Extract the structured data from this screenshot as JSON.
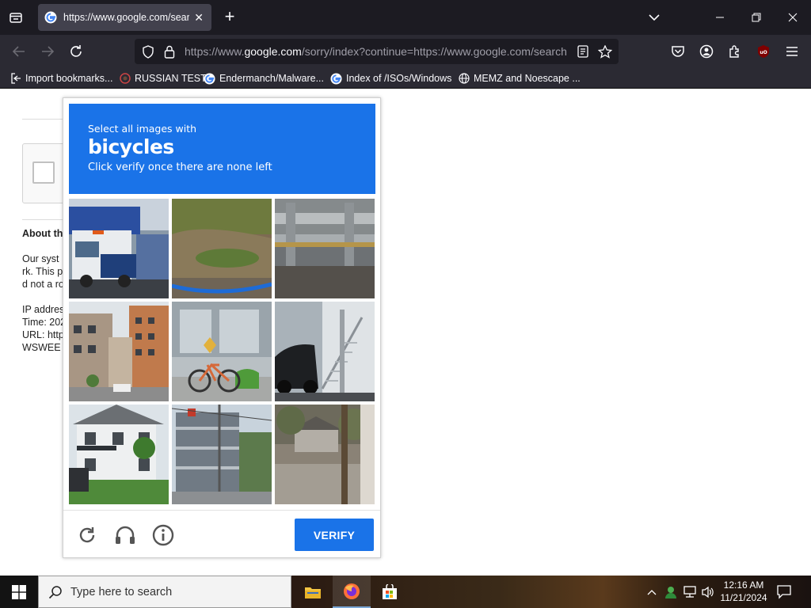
{
  "browser": {
    "tab": {
      "title": "https://www.google.com/search?q=..."
    },
    "url": {
      "prefix": "https://www.",
      "domain": "google.com",
      "rest": "/sorry/index?continue=https://www.google.com/search"
    },
    "bookmarks": [
      {
        "label": "Import bookmarks...",
        "icon": "import-icon"
      },
      {
        "label": "RUSSIAN TEST",
        "icon": "generic-site-icon"
      },
      {
        "label": "Endermanch/Malware...",
        "icon": "google-icon"
      },
      {
        "label": "Index of /ISOs/Windows",
        "icon": "google-icon"
      },
      {
        "label": "MEMZ and Noescape ...",
        "icon": "globe-icon"
      }
    ]
  },
  "page": {
    "about_heading": "About th",
    "para_lines": [
      "Our syst",
      "rk. This p",
      "d not a ro"
    ],
    "info_lines": [
      "IP addres",
      "Time: 202",
      "URL: http",
      "WSWEE"
    ]
  },
  "challenge": {
    "pre": "Select all images with",
    "target": "bicycles",
    "post": "Click verify once there are none left",
    "verify_label": "VERIFY",
    "tiles": [
      "street-truck",
      "ground-basin",
      "guardrail",
      "apartment-street",
      "bicycle-parking",
      "car-staircase",
      "white-house",
      "parking-garage",
      "driveway"
    ]
  },
  "taskbar": {
    "search_placeholder": "Type here to search",
    "time": "12:16 AM",
    "date": "11/21/2024"
  },
  "colors": {
    "accent": "#1a73e8",
    "chrome_dark": "#1c1b22",
    "chrome": "#2b2a33"
  }
}
